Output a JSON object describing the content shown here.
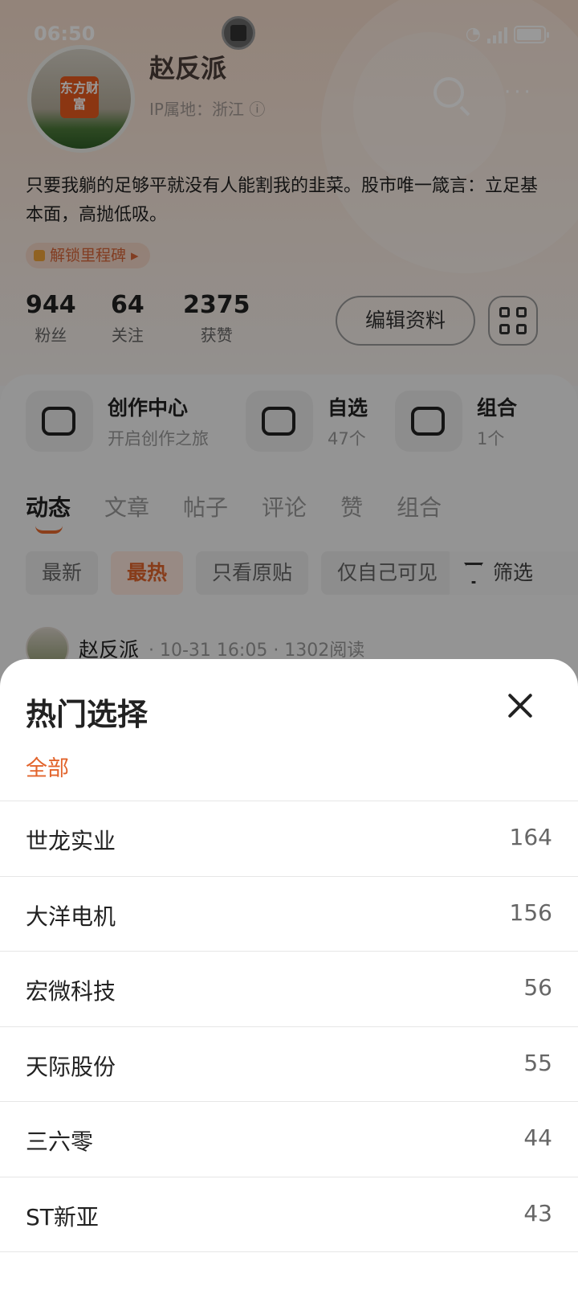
{
  "status_bar": {
    "time": "06:50"
  },
  "profile": {
    "name": "赵反派",
    "ip_location": "IP属地：浙江",
    "avatar_logo_text": "东方财富",
    "bio": "只要我躺的足够平就没有人能割我的韭菜。股市唯一箴言：立足基本面，高抛低吸。",
    "unlock_label": "解锁里程碑",
    "stats": [
      {
        "value": "944",
        "label": "粉丝"
      },
      {
        "value": "64",
        "label": "关注"
      },
      {
        "value": "2375",
        "label": "获赞"
      }
    ],
    "edit_button": "编辑资料"
  },
  "features": [
    {
      "title": "创作中心",
      "sub": "开启创作之旅"
    },
    {
      "title": "自选",
      "sub": "47个"
    },
    {
      "title": "组合",
      "sub": "1个"
    }
  ],
  "tabs": [
    "动态",
    "文章",
    "帖子",
    "评论",
    "赞",
    "组合"
  ],
  "filters": [
    "最新",
    "最热",
    "只看原贴",
    "仅自己可见"
  ],
  "filter_button": "筛选",
  "post": {
    "author": "赵反派",
    "info": "· 10-31 16:05 · 1302阅读"
  },
  "sheet": {
    "title": "热门选择",
    "all_label": "全部",
    "items": [
      {
        "name": "世龙实业",
        "count": "164"
      },
      {
        "name": "大洋电机",
        "count": "156"
      },
      {
        "name": "宏微科技",
        "count": "56"
      },
      {
        "name": "天际股份",
        "count": "55"
      },
      {
        "name": "三六零",
        "count": "44"
      },
      {
        "name": "ST新亚",
        "count": "43"
      }
    ]
  },
  "colors": {
    "accent": "#e2642c",
    "scrim": "rgba(0,0,0,0.40)"
  }
}
